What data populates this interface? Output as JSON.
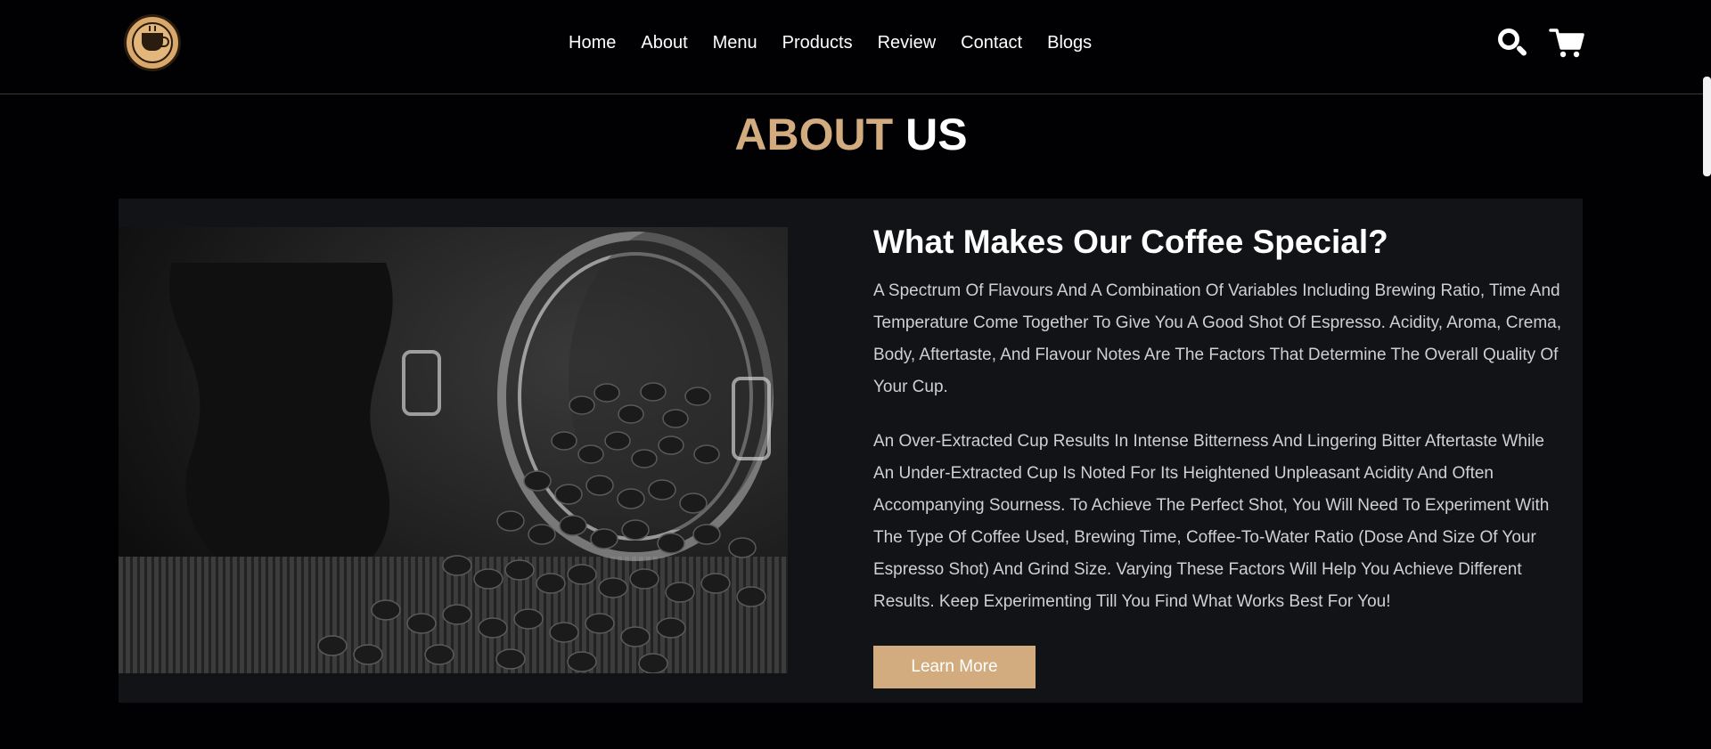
{
  "header": {
    "logo_name": "coffee-shop-logo",
    "nav": [
      {
        "label": "Home"
      },
      {
        "label": "About"
      },
      {
        "label": "Menu"
      },
      {
        "label": "Products"
      },
      {
        "label": "Review"
      },
      {
        "label": "Contact"
      },
      {
        "label": "Blogs"
      }
    ],
    "icons": [
      "search-icon",
      "cart-icon"
    ]
  },
  "section": {
    "title_accent": "ABOUT",
    "title_rest": "US"
  },
  "about": {
    "image_name": "coffee-beans-jar-image",
    "heading": "What Makes Our Coffee Special?",
    "paragraph_1": "A Spectrum Of Flavours And A Combination Of Variables Including Brewing Ratio, Time And Temperature Come Together To Give You A Good Shot Of Espresso. Acidity, Aroma, Crema, Body, Aftertaste, And Flavour Notes Are The Factors That Determine The Overall Quality Of Your Cup.",
    "paragraph_2": "An Over-Extracted Cup Results In Intense Bitterness And Lingering Bitter Aftertaste While An Under-Extracted Cup Is Noted For Its Heightened Unpleasant Acidity And Often Accompanying Sourness. To Achieve The Perfect Shot, You Will Need To Experiment With The Type Of Coffee Used, Brewing Time, Coffee-To-Water Ratio (Dose And Size Of Your Espresso Shot) And Grind Size. Varying These Factors Will Help You Achieve Different Results. Keep Experimenting Till You Find What Works Best For You!",
    "button_label": "Learn More"
  },
  "colors": {
    "background": "#010103",
    "panel": "#121317",
    "accent": "#d2ac7e",
    "text_muted": "#d0d0d0"
  }
}
